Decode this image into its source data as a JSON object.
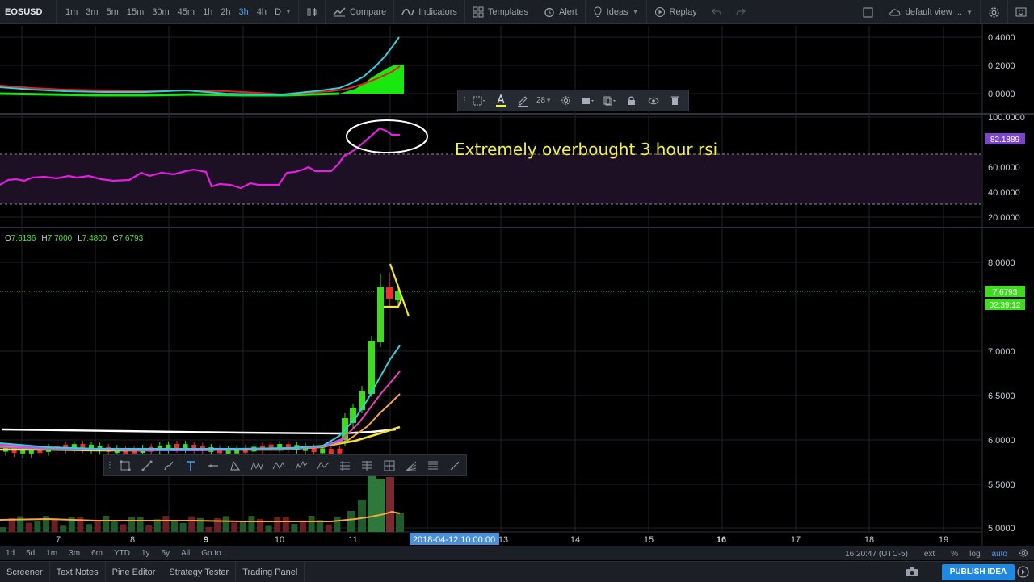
{
  "toolbar": {
    "symbol": "EOSUSD",
    "intervals": [
      "1m",
      "3m",
      "5m",
      "15m",
      "30m",
      "45m",
      "1h",
      "2h",
      "3h",
      "4h",
      "D"
    ],
    "active_interval": "3h",
    "compare_label": "Compare",
    "indicators_label": "Indicators",
    "templates_label": "Templates",
    "alert_label": "Alert",
    "ideas_label": "Ideas",
    "replay_label": "Replay",
    "layout_label": "default view ..."
  },
  "draw_toolbar": {
    "font_size": "28"
  },
  "annotation": {
    "text": "Extremely overbought 3 hour rsi"
  },
  "ohlc": {
    "o_label": "O",
    "o": "7.6136",
    "h_label": "H",
    "h": "7.7000",
    "l_label": "L",
    "l": "7.4800",
    "c_label": "C",
    "c": "7.6793"
  },
  "top_pane_axis": [
    "0.4000",
    "0.2000",
    "0.0000"
  ],
  "rsi_axis": [
    "100.0000",
    "60.0000",
    "40.0000",
    "20.0000"
  ],
  "rsi_value": "82.1889",
  "price_axis": [
    "8.0000",
    "7.0000",
    "6.5000",
    "6.0000",
    "5.5000",
    "5.0000"
  ],
  "last_price": "7.6793",
  "countdown": "02:39:12",
  "time_axis": [
    "7",
    "8",
    "9",
    "10",
    "11",
    "13",
    "14",
    "15",
    "16",
    "17",
    "18",
    "19"
  ],
  "crosshair_date": "2018-04-12 10:00:00",
  "range_bar": {
    "ranges": [
      "1d",
      "5d",
      "1m",
      "3m",
      "6m",
      "YTD",
      "1y",
      "5y",
      "All"
    ],
    "goto": "Go to...",
    "clock": "16:20:47 (UTC-5)",
    "ext": "ext",
    "percent": "%",
    "log": "log",
    "auto": "auto"
  },
  "bottom_tabs": [
    "Screener",
    "Text Notes",
    "Pine Editor",
    "Strategy Tester",
    "Trading Panel"
  ],
  "publish_label": "PUBLISH IDEA",
  "colors": {
    "up": "#3ddc1f",
    "down": "#f0302a",
    "rsi": "#e21fe0",
    "annotation": "#f4f13a",
    "accent": "#1e88e5"
  }
}
